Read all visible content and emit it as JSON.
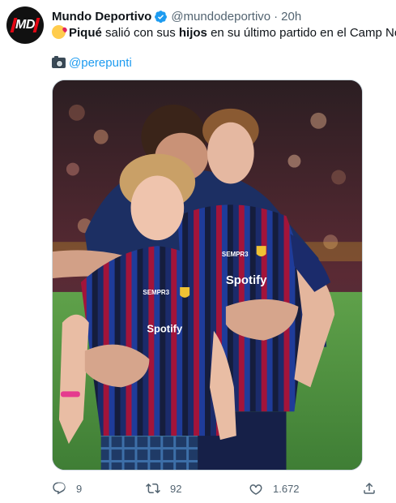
{
  "tweet": {
    "author": {
      "display_name": "Mundo Deportivo",
      "handle": "@mundodeportivo",
      "separator": "·",
      "time": "20h",
      "avatar_text": "MD"
    },
    "text": {
      "part1": "Piqué",
      "part2": " salió con sus ",
      "part3": "hijos",
      "part4": " en su último partido en el Camp Nou"
    },
    "credit": {
      "mention": "@perepunti"
    },
    "media": {
      "kit_sponsor": "Spotify",
      "kit_sponsor_small": "SEMPR3"
    },
    "actions": {
      "reply_count": "9",
      "retweet_count": "92",
      "like_count": "1.672"
    },
    "colors": {
      "accent": "#1d9bf0",
      "verified": "#1d9bf0",
      "muted_text": "#536471"
    },
    "icons": [
      "verified-badge-icon",
      "kiss-emoji-icon",
      "camera-emoji-icon",
      "reply-icon",
      "retweet-icon",
      "like-icon",
      "share-icon"
    ]
  }
}
